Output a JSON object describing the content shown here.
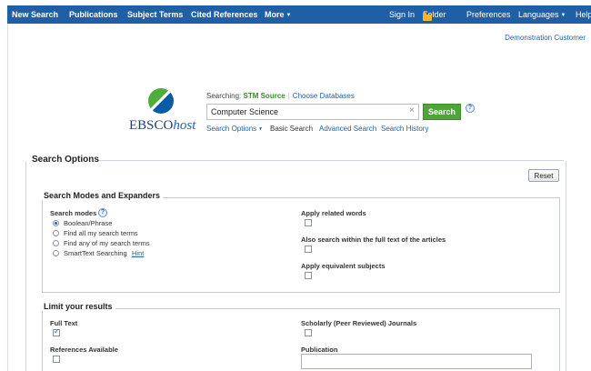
{
  "nav": {
    "left": [
      "New Search",
      "Publications",
      "Subject Terms",
      "Cited References"
    ],
    "more": "More",
    "right": {
      "sign_in": "Sign In",
      "folder": "Folder",
      "preferences": "Preferences",
      "languages": "Languages",
      "help": "Help"
    }
  },
  "account": {
    "customer": "Demonstration Customer"
  },
  "logo": {
    "brand": "EBSCO",
    "suffix": "host"
  },
  "search": {
    "searching_label": "Searching:",
    "database": "STM Source",
    "choose_databases": "Choose Databases",
    "query": "Computer Science",
    "clear": "×",
    "button": "Search",
    "help": "?",
    "links": {
      "search_options": "Search Options",
      "basic_search": "Basic Search",
      "advanced_search": "Advanced Search",
      "search_history": "Search History"
    }
  },
  "options": {
    "title": "Search Options",
    "reset": "Reset",
    "modes_panel": {
      "title": "Search Modes and Expanders",
      "search_modes_label": "Search modes",
      "modes": [
        "Boolean/Phrase",
        "Find all my search terms",
        "Find any of my search terms",
        "SmartText Searching"
      ],
      "selected_mode": 0,
      "hint": "Hint",
      "expanders": [
        {
          "label": "Apply related words",
          "checked": false
        },
        {
          "label": "Also search within the full text of the articles",
          "checked": false
        },
        {
          "label": "Apply equivalent subjects",
          "checked": false
        }
      ]
    },
    "limits_panel": {
      "title": "Limit your results",
      "full_text": {
        "label": "Full Text",
        "checked": true
      },
      "references_available": {
        "label": "References Available",
        "checked": false
      },
      "peer_reviewed": {
        "label": "Scholarly (Peer Reviewed) Journals",
        "checked": false
      },
      "publication_label": "Publication",
      "publication_value": ""
    }
  },
  "colors": {
    "nav_bg": "#1f5fa6",
    "search_button": "#4fa43a",
    "link": "#1e62ad"
  }
}
